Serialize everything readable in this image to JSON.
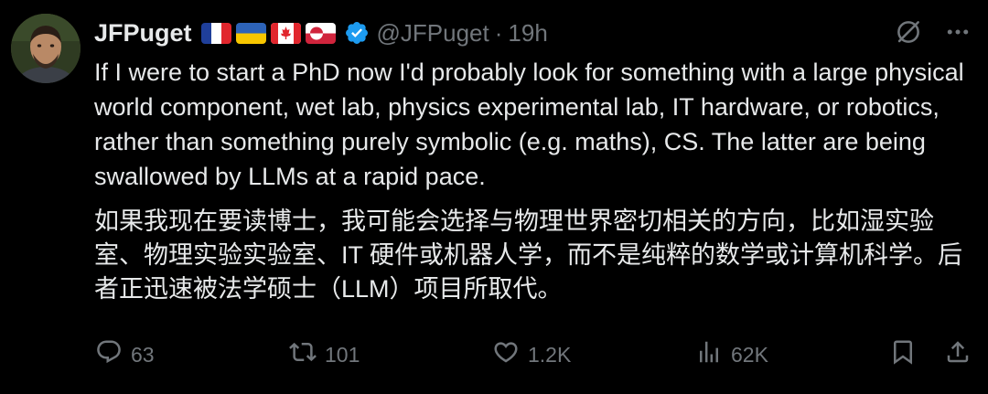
{
  "author": {
    "display_name": "JFPuget",
    "flags": [
      "France",
      "Ukraine",
      "Canada",
      "Greenland"
    ],
    "verified": true,
    "handle": "@JFPuget",
    "separator": "·",
    "time": "19h"
  },
  "tweet": {
    "paragraphs": [
      "If I were to start a PhD now I'd probably look for something with a large physical world component, wet lab, physics experimental lab, IT hardware, or robotics, rather than something purely symbolic (e.g. maths), CS. The latter are being swallowed by LLMs at a rapid pace.",
      "如果我现在要读博士，我可能会选择与物理世界密切相关的方向，比如湿实验室、物理实验实验室、IT 硬件或机器人学，而不是纯粹的数学或计算机科学。后者正迅速被法学硕士（LLM）项目所取代。"
    ]
  },
  "actions": {
    "replies": "63",
    "reposts": "101",
    "likes": "1.2K",
    "views": "62K"
  },
  "icons": {
    "header": [
      "grok-icon",
      "more-icon"
    ],
    "actions": [
      "reply-icon",
      "repost-icon",
      "like-icon",
      "views-icon",
      "bookmark-icon",
      "share-icon"
    ]
  },
  "colors": {
    "background": "#000000",
    "text": "#e7e9ea",
    "muted": "#71767b",
    "verified": "#1d9bf0"
  }
}
